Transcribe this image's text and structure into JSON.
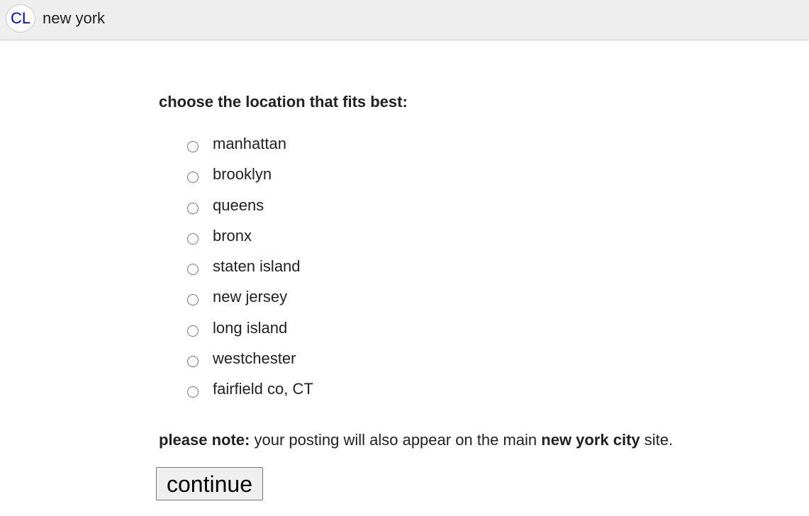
{
  "header": {
    "logo_text": "CL",
    "site_name": "new york"
  },
  "form": {
    "prompt": "choose the location that fits best:",
    "options": [
      {
        "label": "manhattan"
      },
      {
        "label": "brooklyn"
      },
      {
        "label": "queens"
      },
      {
        "label": "bronx"
      },
      {
        "label": "staten island"
      },
      {
        "label": "new jersey"
      },
      {
        "label": "long island"
      },
      {
        "label": "westchester"
      },
      {
        "label": "fairfield co, CT"
      }
    ],
    "note_bold": "please note:",
    "note_text": " your posting will also appear on the main ",
    "note_site": "new york city",
    "note_end": " site.",
    "continue_label": "continue"
  },
  "colors": {
    "header_bg": "#eeeeee",
    "logo_text": "#0000cc",
    "text": "#222222"
  }
}
